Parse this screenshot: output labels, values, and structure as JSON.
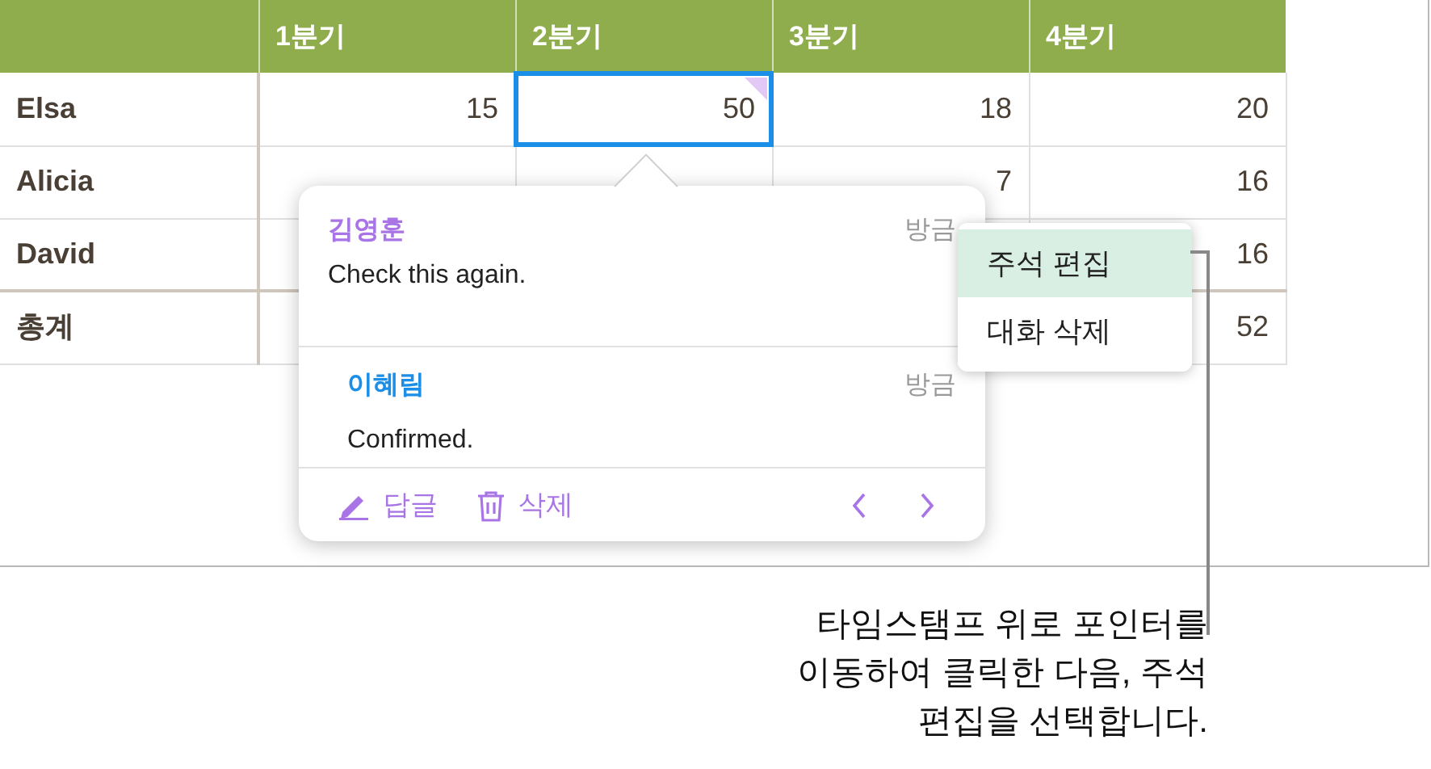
{
  "table": {
    "columns": [
      "1분기",
      "2분기",
      "3분기",
      "4분기"
    ],
    "rows": [
      {
        "label": "Elsa",
        "cells": [
          {
            "value": "15"
          },
          {
            "value": "50",
            "selected": true,
            "comment": true
          },
          {
            "value": "18"
          },
          {
            "value": "20"
          }
        ]
      },
      {
        "label": "Alicia",
        "cells": [
          {},
          {},
          {
            "value": "7"
          },
          {
            "value": "16"
          }
        ]
      },
      {
        "label": "David",
        "cells": [
          {},
          {},
          {},
          {
            "value": "16"
          }
        ]
      },
      {
        "label": "총계",
        "cells": [
          {},
          {},
          {},
          {
            "value": "52"
          }
        ]
      }
    ]
  },
  "comment_popover": {
    "comments": [
      {
        "author": "김영훈",
        "color": "#a874e6",
        "time": "방금",
        "text": "Check this again."
      },
      {
        "author": "이혜림",
        "color": "#1b8fe8",
        "time": "방금",
        "text": "Confirmed."
      }
    ],
    "reply": "답글",
    "delete": "삭제"
  },
  "context_menu": [
    {
      "label": "주석 편집",
      "selected": true
    },
    {
      "label": "대화 삭제",
      "selected": false
    }
  ],
  "caption": [
    "타임스탬프 위로 포인터를",
    "이동하여 클릭한 다음, 주석",
    "편집을 선택합니다."
  ]
}
